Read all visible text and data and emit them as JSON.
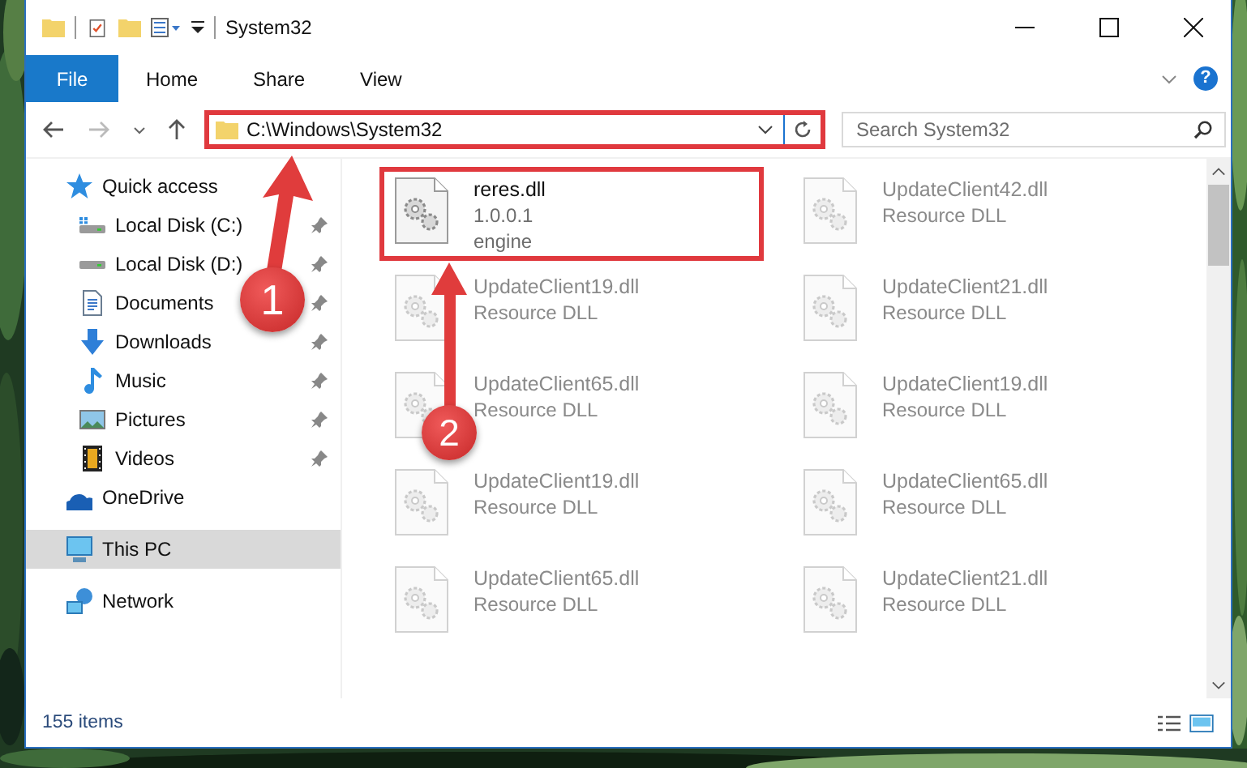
{
  "window": {
    "title": "System32"
  },
  "ribbon": {
    "tabs": [
      {
        "label": "File",
        "selected": true
      },
      {
        "label": "Home",
        "selected": false
      },
      {
        "label": "Share",
        "selected": false
      },
      {
        "label": "View",
        "selected": false
      }
    ],
    "help": "?"
  },
  "address_bar": {
    "path": "C:\\Windows\\System32",
    "highlighted": true
  },
  "search": {
    "placeholder": "Search System32"
  },
  "sidebar": {
    "items": [
      {
        "label": "Quick access",
        "selected": false,
        "children": [
          {
            "label": "Local Disk (C:)",
            "pinned": true,
            "selected": false
          },
          {
            "label": "Local Disk (D:)",
            "pinned": true,
            "selected": false
          },
          {
            "label": "Documents",
            "pinned": true,
            "selected": false
          },
          {
            "label": "Downloads",
            "pinned": true,
            "selected": false
          },
          {
            "label": "Music",
            "pinned": true,
            "selected": false
          },
          {
            "label": "Pictures",
            "pinned": true,
            "selected": false
          },
          {
            "label": "Videos",
            "pinned": true,
            "selected": false
          }
        ]
      },
      {
        "label": "OneDrive",
        "selected": false
      },
      {
        "label": "This PC",
        "selected": true
      },
      {
        "label": "Network",
        "selected": false
      }
    ]
  },
  "files": [
    {
      "name": "reres.dll",
      "lines": [
        "1.0.0.1",
        "engine"
      ],
      "highlighted": true,
      "blurred": false
    },
    {
      "name": "UpdateClient42.dll",
      "lines": [
        "Resource DLL"
      ],
      "highlighted": false,
      "blurred": true
    },
    {
      "name": "UpdateClient19.dll",
      "lines": [
        "Resource DLL"
      ],
      "highlighted": false,
      "blurred": true
    },
    {
      "name": "UpdateClient21.dll",
      "lines": [
        "Resource DLL"
      ],
      "highlighted": false,
      "blurred": true
    },
    {
      "name": "UpdateClient65.dll",
      "lines": [
        "Resource DLL"
      ],
      "highlighted": false,
      "blurred": true
    },
    {
      "name": "UpdateClient19.dll",
      "lines": [
        "Resource DLL"
      ],
      "highlighted": false,
      "blurred": true
    },
    {
      "name": "UpdateClient19.dll",
      "lines": [
        "Resource DLL"
      ],
      "highlighted": false,
      "blurred": true
    },
    {
      "name": "UpdateClient65.dll",
      "lines": [
        "Resource DLL"
      ],
      "highlighted": false,
      "blurred": true
    },
    {
      "name": "UpdateClient65.dll",
      "lines": [
        "Resource DLL"
      ],
      "highlighted": false,
      "blurred": true
    },
    {
      "name": "UpdateClient21.dll",
      "lines": [
        "Resource DLL"
      ],
      "highlighted": false,
      "blurred": true
    }
  ],
  "status_bar": {
    "item_count": "155 items"
  },
  "annotations": [
    {
      "label": "1"
    },
    {
      "label": "2"
    }
  ]
}
